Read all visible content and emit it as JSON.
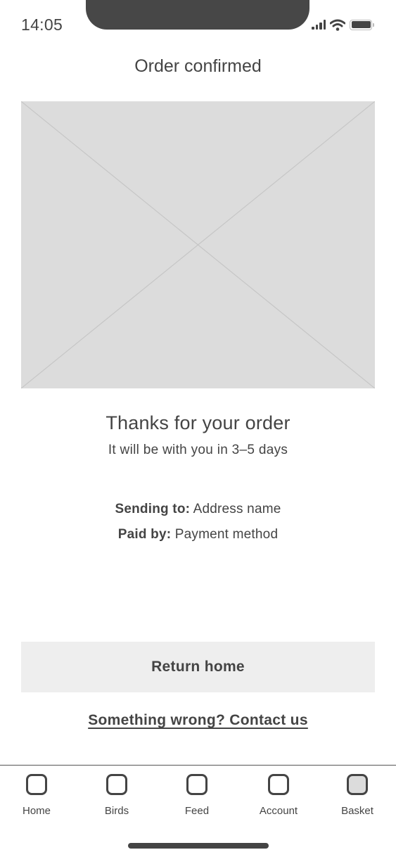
{
  "status_bar": {
    "time": "14:05",
    "icons": [
      "cellular-signal-icon",
      "wifi-icon",
      "battery-icon"
    ]
  },
  "header": {
    "title": "Order confirmed"
  },
  "hero_image": {
    "type": "image-placeholder"
  },
  "confirmation": {
    "heading": "Thanks for your order",
    "eta": "It will be with you in 3–5 days",
    "sending_label": "Sending to:",
    "sending_value": "Address name",
    "paid_label": "Paid by:",
    "paid_value": "Payment method"
  },
  "actions": {
    "return_home_label": "Return home",
    "contact_link_label": "Something wrong? Contact us"
  },
  "tab_bar": {
    "active": "Basket",
    "items": [
      {
        "label": "Home",
        "icon": "home-icon"
      },
      {
        "label": "Birds",
        "icon": "birds-icon"
      },
      {
        "label": "Feed",
        "icon": "feed-icon"
      },
      {
        "label": "Account",
        "icon": "account-icon"
      },
      {
        "label": "Basket",
        "icon": "basket-icon"
      }
    ]
  },
  "colors": {
    "text": "#444444",
    "placeholder_fill": "#dcdcdc",
    "button_fill": "#eeeeee",
    "notch": "#474747"
  }
}
